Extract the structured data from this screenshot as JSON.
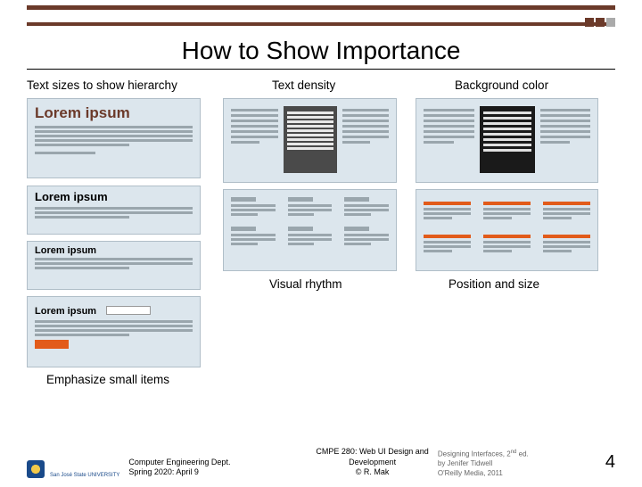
{
  "slide": {
    "title": "How to Show Importance",
    "captions": {
      "col1": "Text sizes to show hierarchy",
      "col2_top": "Text density",
      "col3_top": "Background color",
      "col2_bot": "Visual rhythm",
      "col3_bot": "Position and size",
      "emphasize": "Emphasize small items"
    },
    "wireframe_heading": "Lorem ipsum"
  },
  "footer": {
    "logo_text": "San José State UNIVERSITY",
    "left_line1": "Computer Engineering Dept.",
    "left_line2": "Spring 2020: April 9",
    "mid_line1": "CMPE 280: Web UI Design and Development",
    "mid_line2": "© R. Mak",
    "right_line1_a": "Designing Interfaces, 2",
    "right_line1_b": " ed.",
    "right_sup": "nd",
    "right_line2": "by Jenifer Tidwell",
    "right_line3": "O'Reilly Media, 2011",
    "page": "4"
  }
}
